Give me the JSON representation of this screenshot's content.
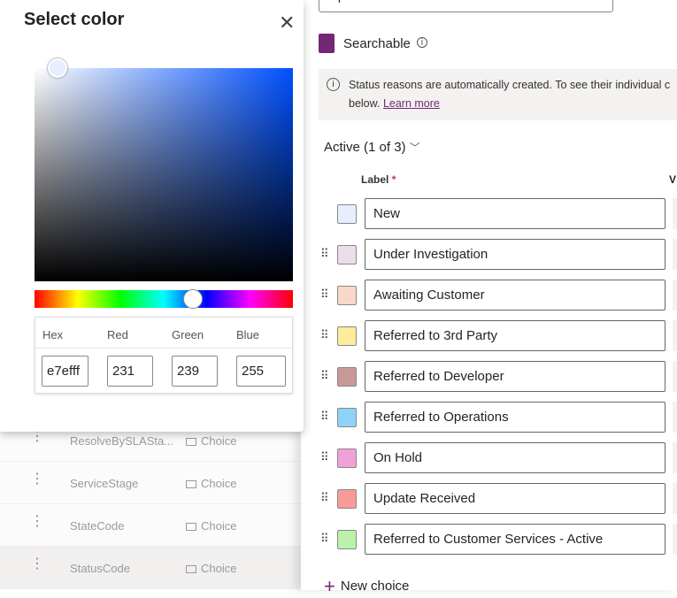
{
  "popup": {
    "title": "Select color",
    "close_icon": "close-icon",
    "selected_hex": "#e7efff",
    "fields": {
      "hex_label": "Hex",
      "red_label": "Red",
      "green_label": "Green",
      "blue_label": "Blue",
      "hex": "e7efff",
      "red": "231",
      "green": "239",
      "blue": "255"
    }
  },
  "list": [
    {
      "name": "ResolveBySLASta...",
      "type": "Choice"
    },
    {
      "name": "ServiceStage",
      "type": "Choice"
    },
    {
      "name": "StateCode",
      "type": "Choice"
    },
    {
      "name": "StatusCode",
      "type": "Choice"
    }
  ],
  "panel": {
    "required_value": "Optional",
    "searchable": "Searchable",
    "info_text": "Status reasons are automatically created. To see their individual c below.",
    "learn_more": "Learn more",
    "group": "Active (1 of 3)",
    "label_header": "Label",
    "required_mark": "*",
    "value_header": "V",
    "new_choice": "New choice",
    "choices": [
      {
        "label": "New",
        "color": "#e7efff"
      },
      {
        "label": "Under Investigation",
        "color": "#ecdcec"
      },
      {
        "label": "Awaiting Customer",
        "color": "#f9d8c8"
      },
      {
        "label": "Referred to 3rd Party",
        "color": "#fcec9c"
      },
      {
        "label": "Referred to Developer",
        "color": "#c99898"
      },
      {
        "label": "Referred to Operations",
        "color": "#8dd3f8"
      },
      {
        "label": "On Hold",
        "color": "#f0a2d8"
      },
      {
        "label": "Update Received",
        "color": "#f99a98"
      },
      {
        "label": "Referred to Customer Services - Active",
        "color": "#bbf2ab"
      }
    ]
  }
}
